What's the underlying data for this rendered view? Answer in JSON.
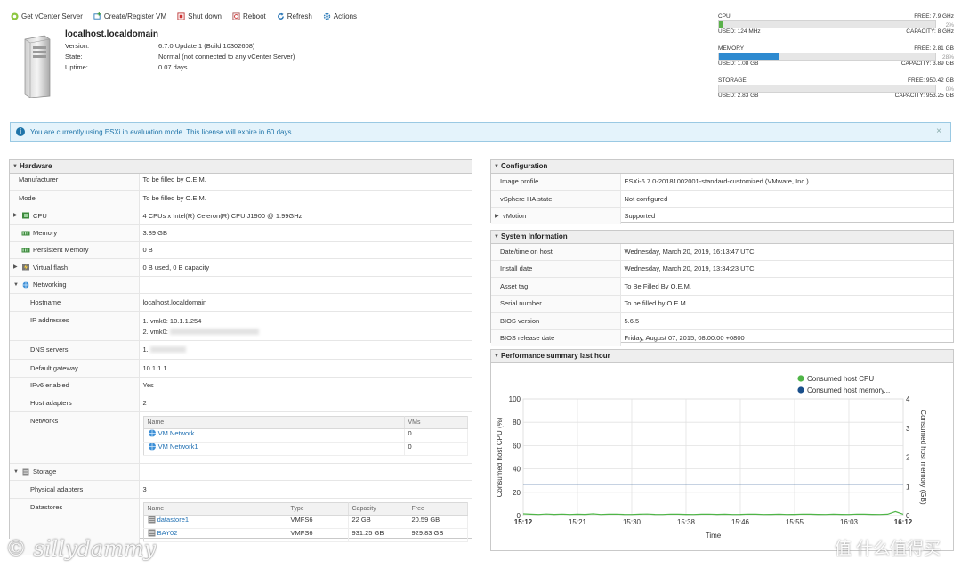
{
  "toolbar": {
    "get_vcenter": "Get vCenter Server",
    "create_vm": "Create/Register VM",
    "shutdown": "Shut down",
    "reboot": "Reboot",
    "refresh": "Refresh",
    "actions": "Actions"
  },
  "host": {
    "name": "localhost.localdomain",
    "version_label": "Version:",
    "version": "6.7.0 Update 1 (Build 10302608)",
    "state_label": "State:",
    "state": "Normal (not connected to any vCenter Server)",
    "uptime_label": "Uptime:",
    "uptime": "0.07 days"
  },
  "resources": {
    "cpu": {
      "label": "CPU",
      "free": "FREE: 7.9 GHz",
      "pct": "2%",
      "used": "USED: 124 MHz",
      "capacity": "CAPACITY: 8 GHz",
      "fill": 0.02,
      "color": "#5ab14a"
    },
    "memory": {
      "label": "MEMORY",
      "free": "FREE: 2.81 GB",
      "pct": "28%",
      "used": "USED: 1.08 GB",
      "capacity": "CAPACITY: 3.89 GB",
      "fill": 0.28,
      "color": "#2e8ad0"
    },
    "storage": {
      "label": "STORAGE",
      "free": "FREE: 950.42 GB",
      "pct": "0%",
      "used": "USED: 2.83 GB",
      "capacity": "CAPACITY: 953.25 GB",
      "fill": 0.0,
      "color": "#2e8ad0"
    }
  },
  "banner": {
    "text": "You are currently using ESXi in evaluation mode. This license will expire in 60 days.",
    "info": "i",
    "close": "×"
  },
  "hardware": {
    "title": "Hardware",
    "manufacturer_label": "Manufacturer",
    "manufacturer": "To be filled by O.E.M.",
    "model_label": "Model",
    "model": "To be filled by O.E.M.",
    "cpu_label": "CPU",
    "cpu": "4 CPUs x Intel(R) Celeron(R) CPU J1900 @ 1.99GHz",
    "memory_label": "Memory",
    "memory": "3.89 GB",
    "pmem_label": "Persistent Memory",
    "pmem": "0 B",
    "vflash_label": "Virtual flash",
    "vflash": "0 B used, 0 B capacity",
    "networking_label": "Networking",
    "hostname_label": "Hostname",
    "hostname": "localhost.localdomain",
    "ip_label": "IP addresses",
    "ip1": "1. vmk0: 10.1.1.254",
    "ip2": "2. vmk0:",
    "dns_label": "DNS servers",
    "dns": "1.",
    "gateway_label": "Default gateway",
    "gateway": "10.1.1.1",
    "ipv6_label": "IPv6 enabled",
    "ipv6": "Yes",
    "adapters_label": "Host adapters",
    "adapters": "2",
    "networks_label": "Networks",
    "networks_head": {
      "name": "Name",
      "vms": "VMs"
    },
    "networks": [
      {
        "name": "VM Network",
        "vms": "0"
      },
      {
        "name": "VM Network1",
        "vms": "0"
      }
    ],
    "storage_label": "Storage",
    "phys_label": "Physical adapters",
    "phys": "3",
    "datastores_label": "Datastores",
    "ds_head": {
      "name": "Name",
      "type": "Type",
      "capacity": "Capacity",
      "free": "Free"
    },
    "datastores": [
      {
        "name": "datastore1",
        "type": "VMFS6",
        "capacity": "22 GB",
        "free": "20.59 GB"
      },
      {
        "name": "BAY02",
        "type": "VMFS6",
        "capacity": "931.25 GB",
        "free": "929.83 GB"
      }
    ]
  },
  "configuration": {
    "title": "Configuration",
    "image_label": "Image profile",
    "image": "ESXi-6.7.0-20181002001-standard-customized (VMware, Inc.)",
    "ha_label": "vSphere HA state",
    "ha": "Not configured",
    "vmotion_label": "vMotion",
    "vmotion": "Supported"
  },
  "sysinfo": {
    "title": "System Information",
    "datetime_label": "Date/time on host",
    "datetime": "Wednesday, March 20, 2019, 16:13:47 UTC",
    "install_label": "Install date",
    "install": "Wednesday, March 20, 2019, 13:34:23 UTC",
    "asset_label": "Asset tag",
    "asset": "To Be Filled By O.E.M.",
    "serial_label": "Serial number",
    "serial": "To be filled by O.E.M.",
    "bios_label": "BIOS version",
    "bios": "5.6.5",
    "biosdate_label": "BIOS release date",
    "biosdate": "Friday, August 07, 2015, 08:00:00 +0800"
  },
  "perf": {
    "title": "Performance summary last hour"
  },
  "watermark": {
    "left": "© sillydammy",
    "right": "值 什么值得买"
  },
  "chart_data": {
    "type": "line",
    "xlabel": "Time",
    "ylabel": "Consumed host CPU (%)",
    "y2label": "Consumed host memory (GB)",
    "x": [
      "15:12",
      "15:21",
      "15:30",
      "15:38",
      "15:46",
      "15:55",
      "16:03",
      "16:12"
    ],
    "ylim": [
      0,
      100
    ],
    "y2lim": [
      0,
      4
    ],
    "yticks": [
      "0",
      "20",
      "40",
      "60",
      "80",
      "100"
    ],
    "y2ticks": [
      "0",
      "1",
      "2",
      "3",
      "4"
    ],
    "grid": true,
    "legend": "top-right",
    "series": [
      {
        "name": "Consumed host CPU",
        "axis": "left",
        "color": "#4fb547",
        "values": [
          1.5,
          1.2,
          1.0,
          1.4,
          1.1,
          1.3,
          1.0,
          1.2,
          1.1,
          1.5,
          1.0,
          1.2,
          1.3,
          1.1,
          1.0,
          1.2,
          1.4,
          1.1,
          1.0,
          1.3,
          1.2,
          1.1,
          1.0,
          1.2,
          1.3,
          1.1,
          1.2,
          1.0,
          1.1,
          1.3,
          1.2,
          1.0,
          1.1,
          1.2,
          1.0,
          1.1,
          1.3,
          1.2,
          1.1,
          1.0,
          1.2,
          1.1,
          1.0,
          1.3,
          1.2,
          1.1,
          1.0,
          1.2,
          3.5,
          1.2
        ]
      },
      {
        "name": "Consumed host memory...",
        "axis": "right",
        "color": "#1a4f8b",
        "values": [
          1.08,
          1.08,
          1.08,
          1.08,
          1.08,
          1.08,
          1.08,
          1.08,
          1.08,
          1.08,
          1.08,
          1.08,
          1.08,
          1.08,
          1.08,
          1.08,
          1.08,
          1.08,
          1.08,
          1.08,
          1.08,
          1.08,
          1.08,
          1.08,
          1.08,
          1.08,
          1.08,
          1.08,
          1.08,
          1.08,
          1.08,
          1.08,
          1.08,
          1.08,
          1.08,
          1.08,
          1.08,
          1.08,
          1.08,
          1.08,
          1.08,
          1.08,
          1.08,
          1.08,
          1.08,
          1.08,
          1.08,
          1.08,
          1.08,
          1.08
        ]
      }
    ]
  }
}
